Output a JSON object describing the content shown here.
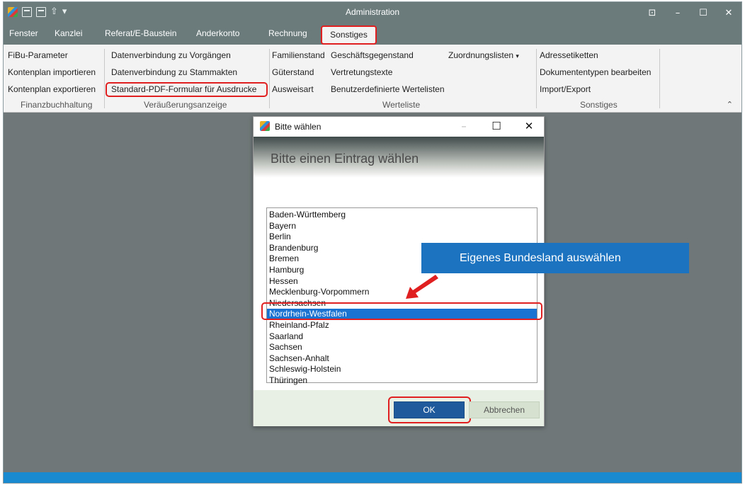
{
  "window": {
    "title": "Administration"
  },
  "menu": {
    "tabs": [
      "Fenster",
      "Kanzlei",
      "Referat/E-Baustein",
      "Anderkonto",
      "Rechnung",
      "Sonstiges"
    ]
  },
  "ribbon": {
    "finanz": {
      "items": [
        "FiBu-Parameter",
        "Kontenplan importieren",
        "Kontenplan exportieren"
      ],
      "group": "Finanzbuchhaltung"
    },
    "veraeusserung": {
      "items": [
        "Datenverbindung zu Vorgängen",
        "Datenverbindung zu Stammakten",
        "Standard-PDF-Formular für Ausdrucke"
      ],
      "group": "Veräußerungsanzeige"
    },
    "werteliste": {
      "col1": [
        "Familienstand",
        "Güterstand",
        "Ausweisart"
      ],
      "col2": [
        "Geschäftsgegenstand",
        "Vertretungstexte",
        "Benutzerdefinierte Wertelisten"
      ],
      "zuordnung": "Zuordnungslisten",
      "group": "Werteliste"
    },
    "sonstiges": {
      "items": [
        "Adressetiketten",
        "Dokumententypen bearbeiten",
        "Import/Export"
      ],
      "group": "Sonstiges"
    }
  },
  "dialog": {
    "title": "Bitte wählen",
    "heading": "Bitte einen Eintrag wählen",
    "items": [
      "Baden-Württemberg",
      "Bayern",
      "Berlin",
      "Brandenburg",
      "Bremen",
      "Hamburg",
      "Hessen",
      "Mecklenburg-Vorpommern",
      "Niedersachsen",
      "Nordrhein-Westfalen",
      "Rheinland-Pfalz",
      "Saarland",
      "Sachsen",
      "Sachsen-Anhalt",
      "Schleswig-Holstein",
      "Thüringen"
    ],
    "selected": "Nordrhein-Westfalen",
    "ok_label": "OK",
    "cancel_label": "Abbrechen"
  },
  "callout": {
    "text": "Eigenes Bundesland auswählen"
  },
  "colors": {
    "accent": "#1a73d0",
    "highlight": "#e02020",
    "callout": "#1c74c0",
    "titlebar": "#6b7b7c"
  }
}
